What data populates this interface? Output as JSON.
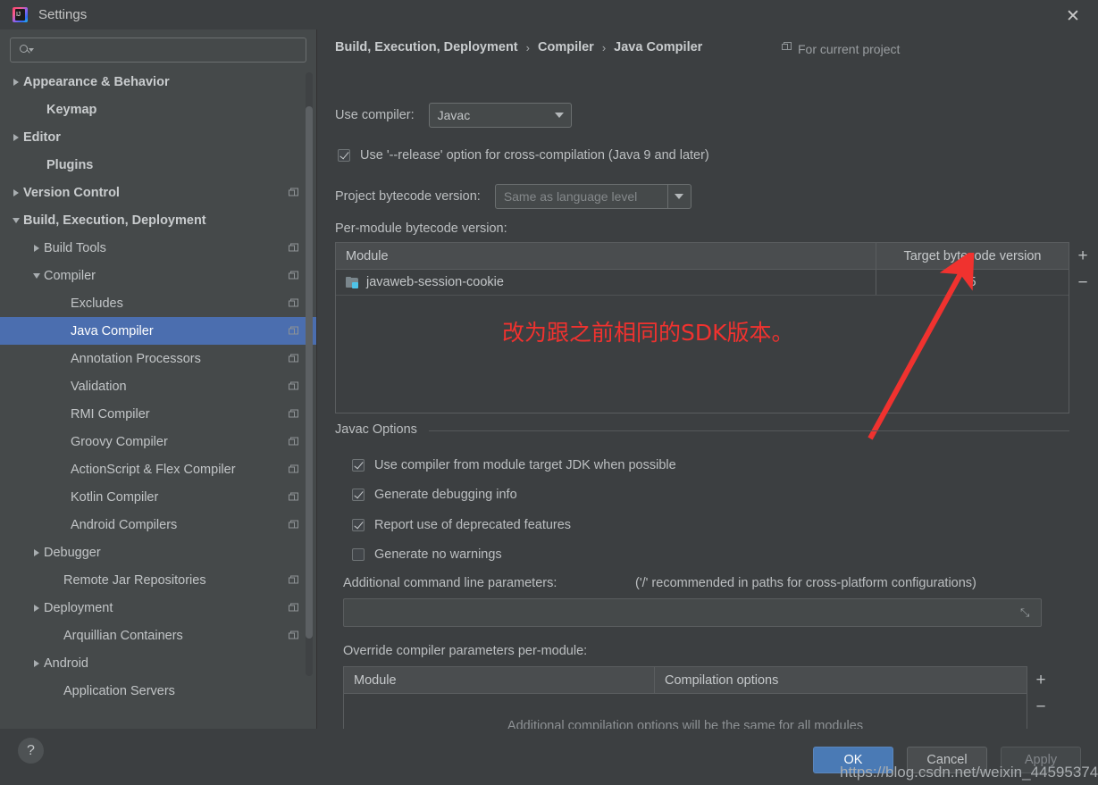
{
  "window": {
    "title": "Settings",
    "logo_text": "IJ",
    "close_icon": "✕"
  },
  "sidebar": {
    "search": {
      "value": "",
      "placeholder": ""
    },
    "items": [
      {
        "label": "Appearance & Behavior",
        "arrow": "collapsed",
        "bold": true,
        "indent": 10,
        "copy": false,
        "selected": false
      },
      {
        "label": "Keymap",
        "arrow": "none",
        "bold": true,
        "indent": 36,
        "copy": false,
        "selected": false
      },
      {
        "label": "Editor",
        "arrow": "collapsed",
        "bold": true,
        "indent": 10,
        "copy": false,
        "selected": false
      },
      {
        "label": "Plugins",
        "arrow": "none",
        "bold": true,
        "indent": 36,
        "copy": false,
        "selected": false
      },
      {
        "label": "Version Control",
        "arrow": "collapsed",
        "bold": true,
        "indent": 10,
        "copy": true,
        "selected": false
      },
      {
        "label": "Build, Execution, Deployment",
        "arrow": "expanded",
        "bold": true,
        "indent": 10,
        "copy": false,
        "selected": false
      },
      {
        "label": "Build Tools",
        "arrow": "collapsed",
        "bold": false,
        "indent": 33,
        "copy": true,
        "selected": false
      },
      {
        "label": "Compiler",
        "arrow": "expanded",
        "bold": false,
        "indent": 33,
        "copy": true,
        "selected": false
      },
      {
        "label": "Excludes",
        "arrow": "none",
        "bold": false,
        "indent": 63,
        "copy": true,
        "selected": false
      },
      {
        "label": "Java Compiler",
        "arrow": "none",
        "bold": false,
        "indent": 63,
        "copy": true,
        "selected": true
      },
      {
        "label": "Annotation Processors",
        "arrow": "none",
        "bold": false,
        "indent": 63,
        "copy": true,
        "selected": false
      },
      {
        "label": "Validation",
        "arrow": "none",
        "bold": false,
        "indent": 63,
        "copy": true,
        "selected": false
      },
      {
        "label": "RMI Compiler",
        "arrow": "none",
        "bold": false,
        "indent": 63,
        "copy": true,
        "selected": false
      },
      {
        "label": "Groovy Compiler",
        "arrow": "none",
        "bold": false,
        "indent": 63,
        "copy": true,
        "selected": false
      },
      {
        "label": "ActionScript & Flex Compiler",
        "arrow": "none",
        "bold": false,
        "indent": 63,
        "copy": true,
        "selected": false
      },
      {
        "label": "Kotlin Compiler",
        "arrow": "none",
        "bold": false,
        "indent": 63,
        "copy": true,
        "selected": false
      },
      {
        "label": "Android Compilers",
        "arrow": "none",
        "bold": false,
        "indent": 63,
        "copy": true,
        "selected": false
      },
      {
        "label": "Debugger",
        "arrow": "collapsed",
        "bold": false,
        "indent": 33,
        "copy": false,
        "selected": false
      },
      {
        "label": "Remote Jar Repositories",
        "arrow": "none",
        "bold": false,
        "indent": 55,
        "copy": true,
        "selected": false
      },
      {
        "label": "Deployment",
        "arrow": "collapsed",
        "bold": false,
        "indent": 33,
        "copy": true,
        "selected": false
      },
      {
        "label": "Arquillian Containers",
        "arrow": "none",
        "bold": false,
        "indent": 55,
        "copy": true,
        "selected": false
      },
      {
        "label": "Android",
        "arrow": "collapsed",
        "bold": false,
        "indent": 33,
        "copy": false,
        "selected": false
      },
      {
        "label": "Application Servers",
        "arrow": "none",
        "bold": false,
        "indent": 55,
        "copy": false,
        "selected": false
      }
    ]
  },
  "main": {
    "breadcrumb": [
      "Build, Execution, Deployment",
      "Compiler",
      "Java Compiler"
    ],
    "breadcrumb_separator": "›",
    "for_current_project": "For current project",
    "use_compiler_label": "Use compiler:",
    "use_compiler_value": "Javac",
    "release_option_label": "Use '--release' option for cross-compilation (Java 9 and later)",
    "release_option_checked": true,
    "project_bytecode_label": "Project bytecode version:",
    "project_bytecode_value": "Same as language level",
    "per_module_label": "Per-module bytecode version:",
    "bytecode_table": {
      "headers": [
        "Module",
        "Target bytecode version"
      ],
      "rows": [
        {
          "module": "javaweb-session-cookie",
          "version": "5"
        }
      ],
      "add_label": "+",
      "remove_label": "−"
    },
    "javac_options": {
      "title": "Javac Options",
      "options": [
        {
          "label": "Use compiler from module target JDK when possible",
          "checked": true
        },
        {
          "label": "Generate debugging info",
          "checked": true
        },
        {
          "label": "Report use of deprecated features",
          "checked": true
        },
        {
          "label": "Generate no warnings",
          "checked": false
        }
      ],
      "additional_params_label": "Additional command line parameters:",
      "additional_params_hint": "('/' recommended in paths for cross-platform configurations)",
      "additional_params_value": "",
      "expand_icon": "⤡"
    },
    "override_label": "Override compiler parameters per-module:",
    "override_table": {
      "headers": [
        "Module",
        "Compilation options"
      ],
      "empty_message": "Additional compilation options will be the same for all modules",
      "add_label": "+",
      "remove_label": "−"
    }
  },
  "annotation": {
    "text": "改为跟之前相同的SDK版本。",
    "color": "#f0322f"
  },
  "footer": {
    "help_label": "?",
    "ok_label": "OK",
    "cancel_label": "Cancel",
    "apply_label": "Apply",
    "watermark": "https://blog.csdn.net/weixin_44595374"
  },
  "colors": {
    "background": "#3c3f41",
    "sidebar": "#45494a",
    "selection": "#4b6eaf",
    "accent_button": "#4a7ab5",
    "annotation_red": "#f0322f"
  }
}
